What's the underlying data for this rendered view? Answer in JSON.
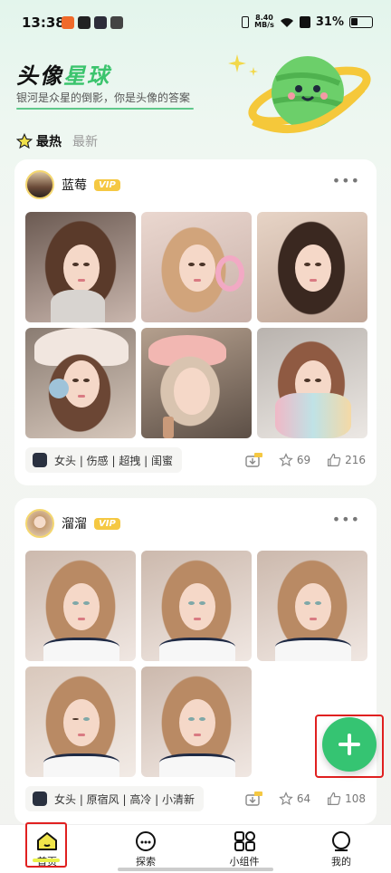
{
  "status_bar": {
    "time": "13:38",
    "speed_top": "8.40",
    "speed_unit": "MB/s",
    "battery": "31%"
  },
  "header": {
    "title_a": "头像",
    "title_b": "星球",
    "subtitle": "银河是众星的倒影，你是头像的答案"
  },
  "tabs": [
    {
      "label": "最热"
    },
    {
      "label": "最新"
    }
  ],
  "posts": [
    {
      "username": "蓝莓",
      "vip": "VIP",
      "tags": "女头 | 伤感 | 超拽 | 闺蜜",
      "stars": "69",
      "likes": "216"
    },
    {
      "username": "溜溜",
      "vip": "VIP",
      "tags": "女头 | 原宿风 | 高冷 | 小清新",
      "stars": "64",
      "likes": "108"
    }
  ],
  "nav": [
    {
      "label": "首页",
      "icon": "home-icon"
    },
    {
      "label": "探索",
      "icon": "explore-icon"
    },
    {
      "label": "小组件",
      "icon": "widget-icon"
    },
    {
      "label": "我的",
      "icon": "profile-icon"
    }
  ],
  "colors": {
    "accent": "#35c472",
    "vip": "#f5c842",
    "highlight": "#e02020"
  }
}
